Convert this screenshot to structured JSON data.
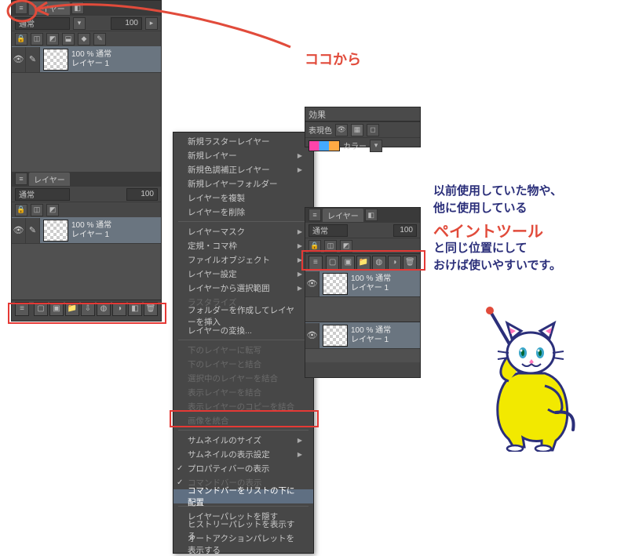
{
  "panels": {
    "left": {
      "tabs": [
        "レイヤー"
      ],
      "blend_mode": "通常",
      "opacity": "100",
      "layer_opacity_label": "100 % 通常",
      "layer_name": "レイヤー 1"
    },
    "right_small": {
      "tabs": [
        "レイヤー"
      ],
      "blend_mode": "通常",
      "opacity": "100",
      "layer_opacity_label": "100 % 通常",
      "layer_name": "レイヤー 1"
    },
    "effects": {
      "tab": "効果",
      "expr_color_label": "表現色",
      "color_label": "カラー"
    }
  },
  "context_menu": {
    "items": [
      {
        "label": "新規ラスターレイヤー",
        "type": "item"
      },
      {
        "label": "新規レイヤー",
        "type": "sub"
      },
      {
        "label": "新規色調補正レイヤー",
        "type": "sub"
      },
      {
        "label": "新規レイヤーフォルダー",
        "type": "item"
      },
      {
        "label": "レイヤーを複製",
        "type": "item"
      },
      {
        "label": "レイヤーを削除",
        "type": "item"
      },
      {
        "type": "sep"
      },
      {
        "label": "レイヤーマスク",
        "type": "sub"
      },
      {
        "label": "定規・コマ枠",
        "type": "sub"
      },
      {
        "label": "ファイルオブジェクト",
        "type": "sub"
      },
      {
        "label": "レイヤー設定",
        "type": "sub"
      },
      {
        "label": "レイヤーから選択範囲",
        "type": "sub"
      },
      {
        "label": "ラスタライズ",
        "type": "item",
        "disabled": true
      },
      {
        "label": "フォルダーを作成してレイヤーを挿入",
        "type": "item"
      },
      {
        "label": "レイヤーの変換...",
        "type": "item"
      },
      {
        "type": "sep"
      },
      {
        "label": "下のレイヤーに転写",
        "type": "item",
        "disabled": true
      },
      {
        "label": "下のレイヤーと結合",
        "type": "item",
        "disabled": true
      },
      {
        "label": "選択中のレイヤーを結合",
        "type": "item",
        "disabled": true
      },
      {
        "label": "表示レイヤーを結合",
        "type": "item",
        "disabled": true
      },
      {
        "label": "表示レイヤーのコピーを結合",
        "type": "item",
        "disabled": true
      },
      {
        "label": "画像を統合",
        "type": "item",
        "disabled": true
      },
      {
        "type": "sep"
      },
      {
        "label": "サムネイルのサイズ",
        "type": "sub"
      },
      {
        "label": "サムネイルの表示設定",
        "type": "sub"
      },
      {
        "label": "プロパティバーの表示",
        "type": "item",
        "checked": true
      },
      {
        "label": "コマンドバーの表示",
        "type": "item",
        "checked": true,
        "disabled": true
      },
      {
        "label": "コマンドバーをリストの下に配置",
        "type": "item",
        "highlight": true
      },
      {
        "type": "sep"
      },
      {
        "label": "レイヤーパレットを隠す",
        "type": "item"
      },
      {
        "label": "ヒストリーパレットを表示する",
        "type": "item"
      },
      {
        "label": "オートアクションパレットを表示する",
        "type": "item"
      }
    ]
  },
  "annotations": {
    "top": "ココから",
    "line1": "以前使用していた物や、",
    "line2": "他に使用している",
    "line3": "ペイントツール",
    "line4": "と同じ位置にして",
    "line5": "おけば使いやすいです。"
  }
}
